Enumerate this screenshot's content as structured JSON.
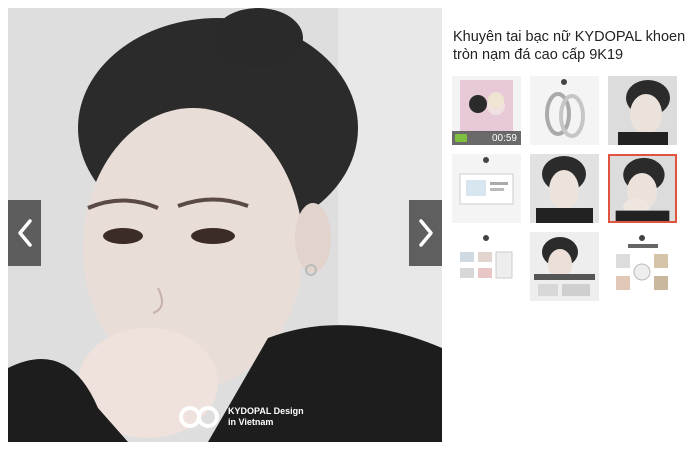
{
  "product": {
    "title": "Khuyên tai bạc nữ KYDOPAL khoen tròn nạm đá cao cấp 9K19"
  },
  "brand": {
    "line1": "KYDOPAL Design",
    "line2": "in Vietnam"
  },
  "gallery": {
    "video_duration": "00:59",
    "active_index": 5,
    "thumbnails": [
      {
        "kind": "video"
      },
      {
        "kind": "earring-product"
      },
      {
        "kind": "model-photo"
      },
      {
        "kind": "product-box"
      },
      {
        "kind": "model-photo"
      },
      {
        "kind": "model-photo"
      },
      {
        "kind": "certificate"
      },
      {
        "kind": "model-ad"
      },
      {
        "kind": "care-guide"
      }
    ]
  },
  "colors": {
    "active_border": "#e0533f",
    "nav_button": "#464646"
  }
}
